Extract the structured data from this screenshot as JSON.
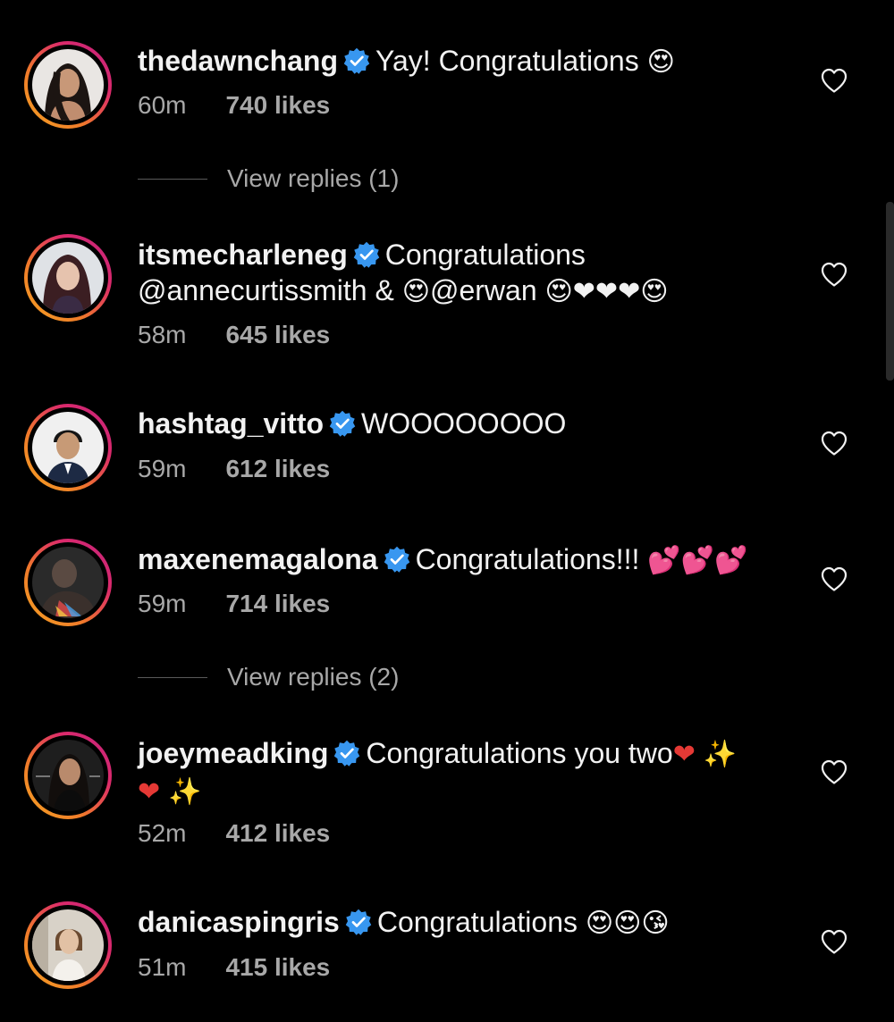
{
  "colors": {
    "background": "#000000",
    "text": "#f2f2f2",
    "muted": "#a8a8a8",
    "verified": "#3897f0",
    "ring": "#dc2a6b"
  },
  "icons": {
    "verified": "verified-badge-icon",
    "like": "heart-outline-icon"
  },
  "comments": [
    {
      "username": "thedawnchang",
      "text": "Yay! Congratulations",
      "emojis": "😍",
      "time": "60m",
      "likes": "740 likes",
      "view_replies": "View replies (1)"
    },
    {
      "username": "itsmecharleneg",
      "text": "Congratulations",
      "text2": "@annecurtissmith & ",
      "emoji_a": "😍",
      "mention2": "@erwan ",
      "emojis": "😍❤❤❤😍",
      "time": "58m",
      "likes": "645 likes"
    },
    {
      "username": "hashtag_vitto",
      "text": "WOOOOOOOO",
      "time": "59m",
      "likes": "612 likes"
    },
    {
      "username": "maxenemagalona",
      "text": "Congratulations!!!",
      "emojis": "💕💕💕",
      "time": "59m",
      "likes": "714 likes",
      "view_replies": "View replies (2)"
    },
    {
      "username": "joeymeadking",
      "text": "Congratulations you two",
      "emoji_a": "❤",
      "emoji_b": "✨",
      "emoji_c": "❤",
      "emoji_d": "✨",
      "time": "52m",
      "likes": "412 likes"
    },
    {
      "username": "danicaspingris",
      "text": "Congratulations",
      "emojis": "😍😍😘",
      "time": "51m",
      "likes": "415 likes"
    }
  ]
}
